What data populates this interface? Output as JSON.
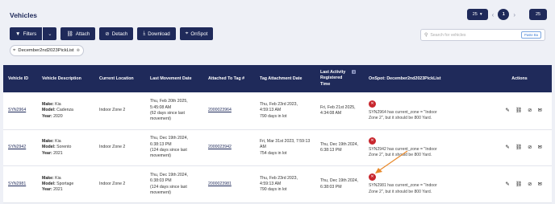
{
  "header": {
    "title": "Vehicles"
  },
  "pagination": {
    "page_size": "25",
    "prev": "‹",
    "current": "1",
    "next": "›",
    "total": "25"
  },
  "toolbar": {
    "filters": "Filters",
    "attach": "Attach",
    "detach": "Detach",
    "download": "Download",
    "onspot": "OnSpot"
  },
  "search": {
    "placeholder": "Search for vehicles",
    "paste": "Paste Ba"
  },
  "chip": {
    "label": "December2nd2023PickList"
  },
  "table": {
    "headers": {
      "vehicle_id": "Vehicle ID",
      "description": "Vehicle Description",
      "location": "Current Location",
      "last_movement": "Last Movement Date",
      "attached_tag": "Attached To Tag #",
      "tag_attachment": "Tag Attachment Date",
      "last_activity_1": "Last Activity",
      "last_activity_2": "Registered",
      "last_activity_3": "Time",
      "onspot": "OnSpot: December2nd2023PickList",
      "actions": "Actions"
    },
    "labels": {
      "make": "Make:",
      "model": "Model:",
      "year": "Year:"
    },
    "rows": [
      {
        "id": "SYN2964",
        "make": "Kia",
        "model": "Cadenza",
        "year": "2020",
        "location": "Indoor Zone 2",
        "mov1": "Thu, Feb 20th 2025,",
        "mov2": "5:45:08 AM",
        "mov3": "(62 days since last",
        "mov4": "movement)",
        "tag": "2000023964",
        "tagd1": "Thu, Feb 23rd 2023,",
        "tagd2": "4:59:13 AM",
        "tagd3": "790 days in lot",
        "act1": "Fri, Feb 21st 2025,",
        "act2": "4:34:08 AM",
        "msg1": "SYN2964 has current_zone = \"Indoor",
        "msg2": "Zone 2\", but it should be 800 Yard."
      },
      {
        "id": "SYN2942",
        "make": "Kia",
        "model": "Sorento",
        "year": "2021",
        "location": "Indoor Zone 2",
        "mov1": "Thu, Dec 19th 2024,",
        "mov2": "6:38:13 PM",
        "mov3": "(124 days since last",
        "mov4": "movement)",
        "tag": "2000023942",
        "tagd1": "Fri, Mar 31st 2023, 7:59:13",
        "tagd2": "AM",
        "tagd3": "754 days in lot",
        "act1": "Thu, Dec 19th 2024,",
        "act2": "6:38:13 PM",
        "msg1": "SYN2942 has current_zone = \"Indoor",
        "msg2": "Zone 2\", but it should be 800 Yard."
      },
      {
        "id": "SYN2981",
        "make": "Kia",
        "model": "Sportage",
        "year": "2021",
        "location": "Indoor Zone 2",
        "mov1": "Thu, Dec 19th 2024,",
        "mov2": "6:38:03 PM",
        "mov3": "(124 days since last",
        "mov4": "movement)",
        "tag": "2000023981",
        "tagd1": "Thu, Feb 23rd 2023,",
        "tagd2": "4:59:13 AM",
        "tagd3": "790 days in lot",
        "act1": "Thu, Dec 19th 2024,",
        "act2": "6:38:03 PM",
        "msg1": "SYN2981 has current_zone = \"Indoor",
        "msg2": "Zone 2\", but it should be 800 Yard."
      }
    ]
  },
  "colors": {
    "primary": "#1f2a5a",
    "error": "#c8262d",
    "annotation_arrow": "#e8892b"
  },
  "icons": [
    "filter-icon",
    "link-icon",
    "unlink-icon",
    "download-icon",
    "location-pin-icon",
    "search-icon",
    "error-icon",
    "edit-icon",
    "mail-icon"
  ]
}
